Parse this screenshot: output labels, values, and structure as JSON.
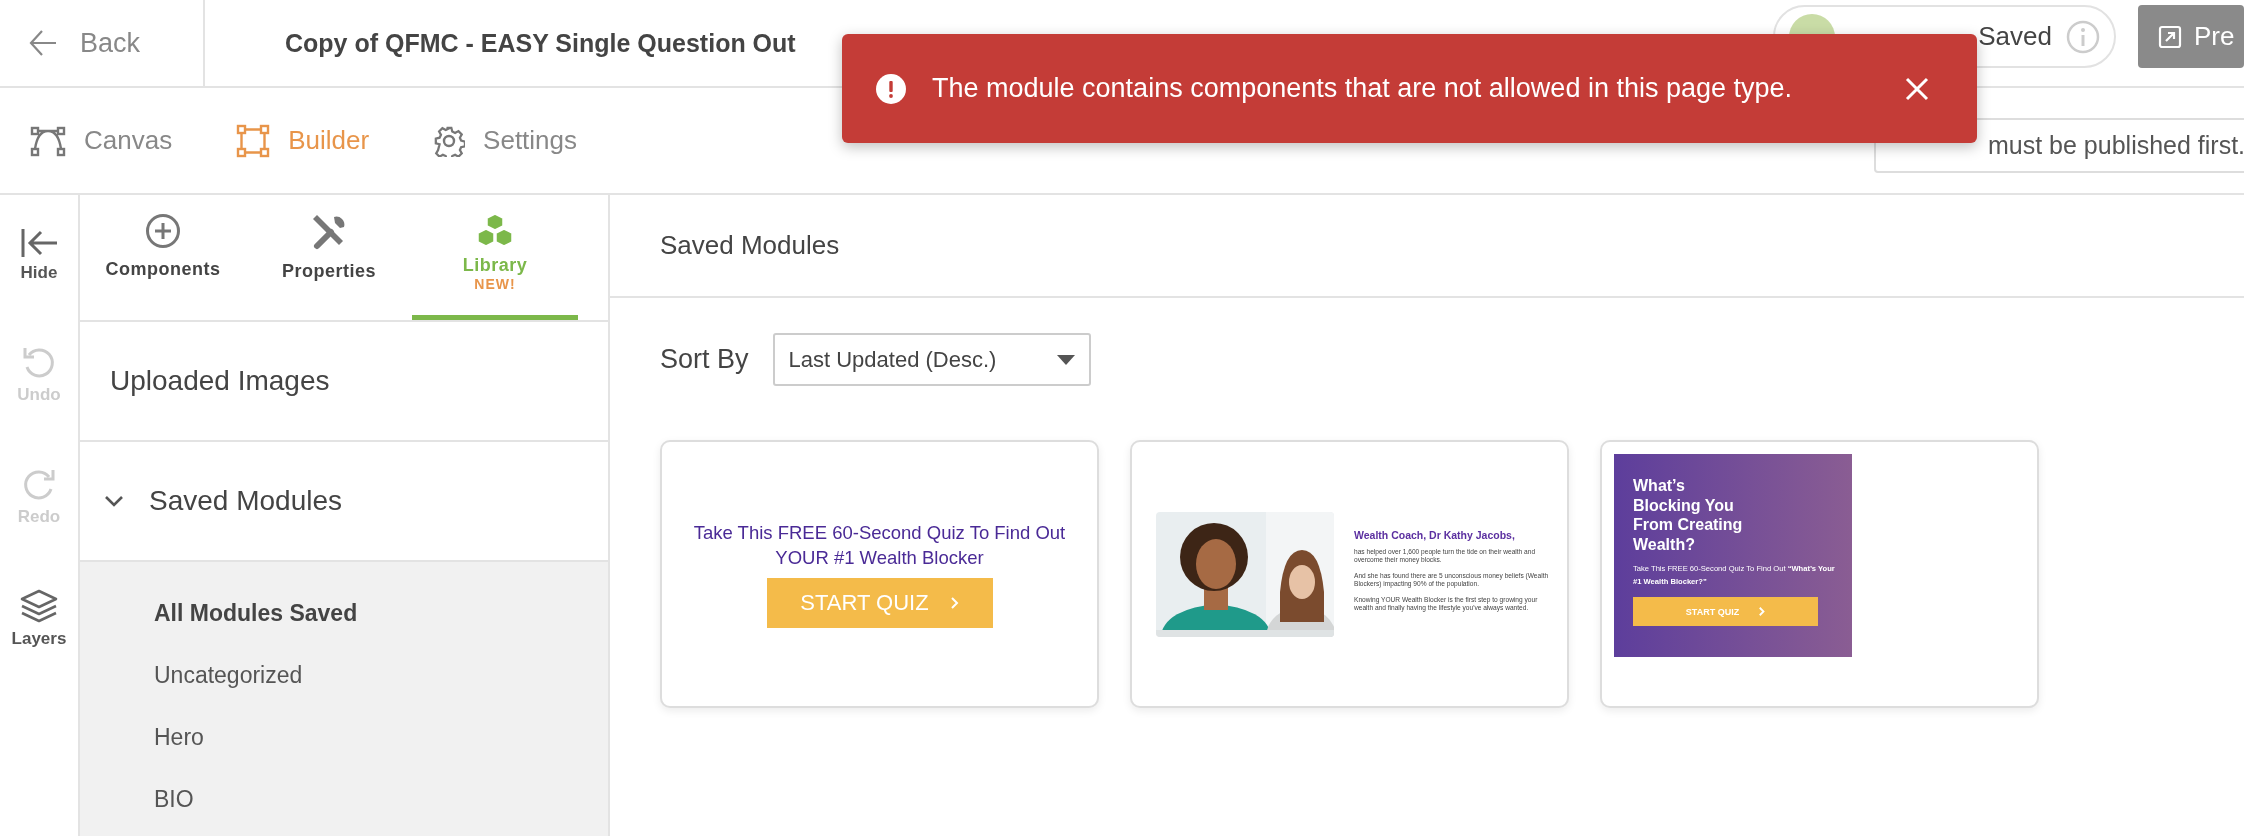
{
  "header": {
    "back": "Back",
    "title": "Copy of QFMC - EASY Single Question Out",
    "status": "Saved",
    "preview": "Pre"
  },
  "toast": {
    "message": "The module contains components that are not allowed in this page type."
  },
  "mode_tabs": [
    {
      "label": "Canvas",
      "kind": "canvas",
      "selected": false
    },
    {
      "label": "Builder",
      "kind": "builder",
      "selected": true
    },
    {
      "label": "Settings",
      "kind": "settings",
      "selected": false
    }
  ],
  "funnel_link": {
    "value": "must be published first."
  },
  "rail": [
    {
      "label": "Hide",
      "kind": "hide",
      "disabled": false
    },
    {
      "label": "Undo",
      "kind": "undo",
      "disabled": true
    },
    {
      "label": "Redo",
      "kind": "redo",
      "disabled": true
    },
    {
      "label": "Layers",
      "kind": "layers",
      "disabled": false
    }
  ],
  "panel_tabs": [
    {
      "label": "Components",
      "kind": "components",
      "selected": false
    },
    {
      "label": "Properties",
      "kind": "properties",
      "selected": false
    },
    {
      "label": "Library",
      "kind": "library",
      "badge": "NEW!",
      "selected": true
    }
  ],
  "sections": [
    {
      "label": "Uploaded Images"
    },
    {
      "label": "Saved Modules",
      "expanded": true
    }
  ],
  "categories": [
    {
      "label": "All Modules Saved",
      "selected": true
    },
    {
      "label": "Uncategorized",
      "selected": false
    },
    {
      "label": "Hero",
      "selected": false
    },
    {
      "label": "BIO",
      "selected": false
    }
  ],
  "main": {
    "title": "Saved Modules",
    "sort_label": "Sort By",
    "sort_value": "Last Updated (Desc.)"
  },
  "modules": [
    {
      "kind": "cta",
      "headline": "Take This FREE 60-Second Quiz To Find Out YOUR #1 Wealth Blocker",
      "button": "START QUIZ"
    },
    {
      "kind": "bio",
      "heading": "Wealth Coach, Dr Kathy Jacobs,",
      "paragraphs": [
        "has helped over 1,600 people turn the tide on their wealth and overcome their money blocks.",
        "And she has found there are 5 unconscious money beliefs (Wealth Blockers) impacting 90% of the population.",
        "Knowing YOUR Wealth Blocker is the first step to growing your wealth and finally having the lifestyle you've always wanted."
      ]
    },
    {
      "kind": "banner",
      "headline": "What’s Blocking You From Creating Wealth?",
      "subtext": "Take This FREE 60-Second Quiz To Find Out **“What’s Your #1 Wealth Blocker?”**",
      "button": "START QUIZ"
    }
  ]
}
